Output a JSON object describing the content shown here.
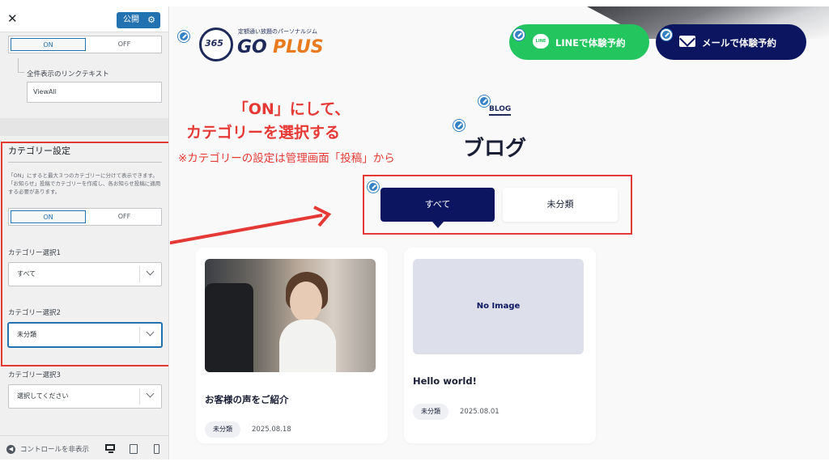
{
  "customizer": {
    "close_icon": "close-icon",
    "publish_label": "公開",
    "toggle_top": {
      "on": "ON",
      "off": "OFF",
      "selected": "ON"
    },
    "link_text_label": "全件表示のリンクテキスト",
    "link_text_value": "ViewAll",
    "category_section": {
      "title": "カテゴリー設定",
      "description": "「ON」にすると最大３つのカテゴリーに分けて表示できます。「お知らせ」投稿でカテゴリーを作成し、各お知らせ投稿に適用する必要があります。",
      "toggle": {
        "on": "ON",
        "off": "OFF",
        "selected": "ON"
      },
      "select1_label": "カテゴリー選択1",
      "select1_value": "すべて",
      "select2_label": "カテゴリー選択2",
      "select2_value": "未分類",
      "select3_label": "カテゴリー選択3",
      "select3_value": "選択してください"
    },
    "hide_controls": "コントロールを非表示",
    "devices": [
      "desktop-icon",
      "tablet-icon",
      "mobile-icon"
    ]
  },
  "preview": {
    "logo": {
      "number": "365",
      "tagline": "定額通い放題のパーソナルジム",
      "go": "GO",
      "plus": "PLUS"
    },
    "line_button": "LINEで体験予約",
    "line_icon_text": "LINE",
    "mail_button": "メールで体験予約",
    "annotation": {
      "line1": "「ON」にして、",
      "line2": "カテゴリーを選択する",
      "line3": "※カテゴリーの設定は管理画面「投稿」から"
    },
    "blog_en": "BLOG",
    "blog_title": "ブログ",
    "tabs": [
      "すべて",
      "未分類"
    ],
    "posts": [
      {
        "title": "お客様の声をご紹介",
        "category": "未分類",
        "date": "2025.08.18",
        "image": "photo"
      },
      {
        "title": "Hello world!",
        "category": "未分類",
        "date": "2025.08.01",
        "image": "No Image"
      }
    ]
  },
  "colors": {
    "accent_red": "#e53935",
    "navy": "#0b1560",
    "line_green": "#22c55e",
    "wp_blue": "#2271b1",
    "orange": "#e87b1f"
  }
}
